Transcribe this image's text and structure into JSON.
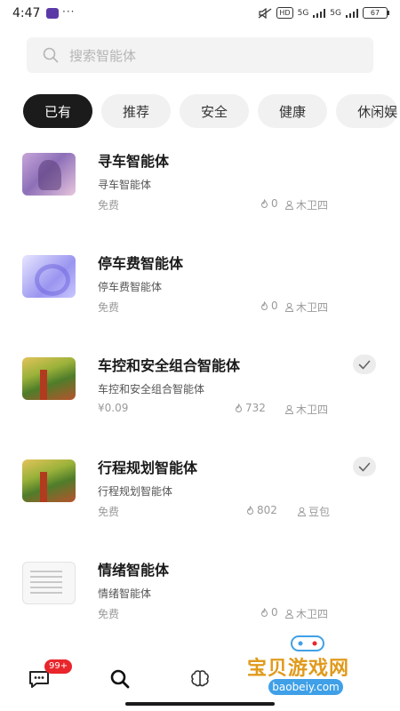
{
  "status_bar": {
    "time": "4:47",
    "dots": "···",
    "hd_label": "HD",
    "net1": "5G",
    "net2": "5G",
    "battery": "67"
  },
  "search": {
    "placeholder": "搜索智能体"
  },
  "categories": [
    {
      "label": "已有",
      "active": true
    },
    {
      "label": "推荐",
      "active": false
    },
    {
      "label": "安全",
      "active": false
    },
    {
      "label": "健康",
      "active": false
    },
    {
      "label": "休闲娱",
      "active": false
    }
  ],
  "agents": [
    {
      "title": "寻车智能体",
      "desc": "寻车智能体",
      "price": "免费",
      "uses": "0",
      "author": "木卫四",
      "checked": false,
      "thumb": "purple-creature-image"
    },
    {
      "title": "停车费智能体",
      "desc": "停车费智能体",
      "price": "免费",
      "uses": "0",
      "author": "木卫四",
      "checked": false,
      "thumb": "violet-coin-image"
    },
    {
      "title": "车控和安全组合智能体",
      "desc": "车控和安全组合智能体",
      "price": "¥0.09",
      "uses": "732",
      "author": "木卫四",
      "checked": true,
      "thumb": "autumn-tree-image"
    },
    {
      "title": "行程规划智能体",
      "desc": "行程规划智能体",
      "price": "免费",
      "uses": "802",
      "author": "豆包",
      "checked": true,
      "thumb": "autumn-tree-image"
    },
    {
      "title": "情绪智能体",
      "desc": "情绪智能体",
      "price": "免费",
      "uses": "0",
      "author": "木卫四",
      "checked": false,
      "thumb": "document-preview-image"
    }
  ],
  "tab_bar": {
    "message_badge": "99+",
    "tabs": [
      "message-icon",
      "search-icon",
      "brain-icon"
    ]
  },
  "watermark": {
    "text": "宝贝游戏网",
    "url": "baobeiy.com"
  },
  "colors": {
    "active_chip": "#1b1b1b",
    "badge_red": "#e8262b",
    "chip_bg": "#f1f1f1"
  }
}
